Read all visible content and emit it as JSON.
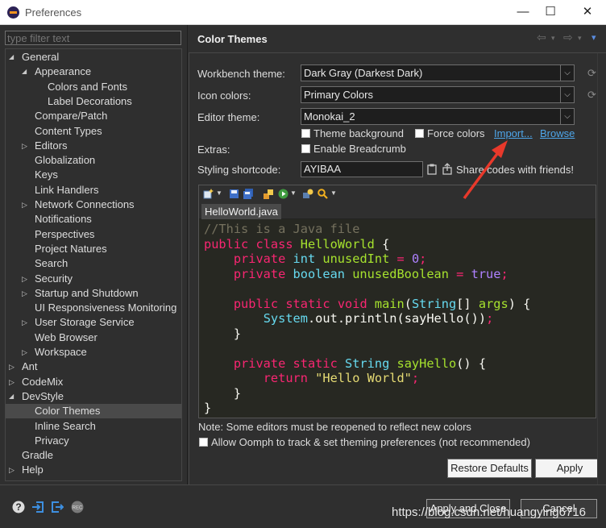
{
  "window": {
    "title": "Preferences",
    "controls": [
      "—",
      "☐",
      "✕"
    ]
  },
  "sidebar": {
    "filter_placeholder": "type filter text",
    "items": [
      {
        "label": "General",
        "level": 0,
        "state": "expanded"
      },
      {
        "label": "Appearance",
        "level": 1,
        "state": "expanded"
      },
      {
        "label": "Colors and Fonts",
        "level": 2,
        "state": "leaf"
      },
      {
        "label": "Label Decorations",
        "level": 2,
        "state": "leaf"
      },
      {
        "label": "Compare/Patch",
        "level": 1,
        "state": "leaf"
      },
      {
        "label": "Content Types",
        "level": 1,
        "state": "leaf"
      },
      {
        "label": "Editors",
        "level": 1,
        "state": "collapsed"
      },
      {
        "label": "Globalization",
        "level": 1,
        "state": "leaf"
      },
      {
        "label": "Keys",
        "level": 1,
        "state": "leaf"
      },
      {
        "label": "Link Handlers",
        "level": 1,
        "state": "leaf"
      },
      {
        "label": "Network Connections",
        "level": 1,
        "state": "collapsed"
      },
      {
        "label": "Notifications",
        "level": 1,
        "state": "leaf"
      },
      {
        "label": "Perspectives",
        "level": 1,
        "state": "leaf"
      },
      {
        "label": "Project Natures",
        "level": 1,
        "state": "leaf"
      },
      {
        "label": "Search",
        "level": 1,
        "state": "leaf"
      },
      {
        "label": "Security",
        "level": 1,
        "state": "collapsed"
      },
      {
        "label": "Startup and Shutdown",
        "level": 1,
        "state": "collapsed"
      },
      {
        "label": "UI Responsiveness Monitoring",
        "level": 1,
        "state": "leaf"
      },
      {
        "label": "User Storage Service",
        "level": 1,
        "state": "collapsed"
      },
      {
        "label": "Web Browser",
        "level": 1,
        "state": "leaf"
      },
      {
        "label": "Workspace",
        "level": 1,
        "state": "collapsed"
      },
      {
        "label": "Ant",
        "level": 0,
        "state": "collapsed"
      },
      {
        "label": "CodeMix",
        "level": 0,
        "state": "collapsed"
      },
      {
        "label": "DevStyle",
        "level": 0,
        "state": "expanded"
      },
      {
        "label": "Color Themes",
        "level": 1,
        "state": "leaf",
        "selected": true
      },
      {
        "label": "Inline Search",
        "level": 1,
        "state": "leaf"
      },
      {
        "label": "Privacy",
        "level": 1,
        "state": "leaf"
      },
      {
        "label": "Gradle",
        "level": 0,
        "state": "leaf"
      },
      {
        "label": "Help",
        "level": 0,
        "state": "collapsed"
      }
    ]
  },
  "page": {
    "title": "Color Themes",
    "nav": {
      "back": "⇦",
      "forward": "⇨",
      "menu": "▾"
    },
    "workbench_theme": {
      "label": "Workbench theme:",
      "value": "Dark Gray (Darkest Dark)"
    },
    "icon_colors": {
      "label": "Icon colors:",
      "value": "Primary Colors"
    },
    "editor_theme": {
      "label": "Editor theme:",
      "value": "Monokai_2"
    },
    "theme_background": {
      "label": "Theme background",
      "checked": false
    },
    "force_colors": {
      "label": "Force colors",
      "checked": false
    },
    "import_link": "Import...",
    "browse_link": "Browse",
    "extras": {
      "label": "Extras:",
      "breadcrumb": {
        "label": "Enable Breadcrumb",
        "checked": false
      }
    },
    "shortcode": {
      "label": "Styling shortcode:",
      "value": "AYIBAA",
      "share": "Share codes with friends!"
    },
    "preview": {
      "tab": "HelloWorld.java",
      "code_lines": [
        "//This is a Java file",
        "public class HelloWorld {",
        "    private int unusedInt = 0;",
        "    private boolean unusedBoolean = true;",
        "",
        "    public static void main(String[] args) {",
        "        System.out.println(sayHello());",
        "    }",
        "",
        "    private static String sayHello() {",
        "        return \"Hello World\";",
        "    }",
        "}"
      ]
    },
    "note": "Note: Some editors must be reopened to reflect new colors",
    "oomph": {
      "label": "Allow Oomph to track & set theming preferences (not recommended)",
      "checked": false
    },
    "restore_defaults": "Restore Defaults",
    "apply": "Apply"
  },
  "footer": {
    "apply_and_close": "Apply and Close",
    "cancel": "Cancel",
    "watermark": "https://blog.csdn.net/huangying6716"
  },
  "colors": {
    "background": "#2f2f2f",
    "editor_bg": "#272822",
    "link": "#4ea6ea",
    "annotation_arrow": "#e8392b",
    "keyword": "#f92672",
    "class_name": "#a6e22e",
    "type": "#66d9ef",
    "number": "#ae81ff",
    "string": "#e6db74",
    "comment": "#75715e"
  }
}
